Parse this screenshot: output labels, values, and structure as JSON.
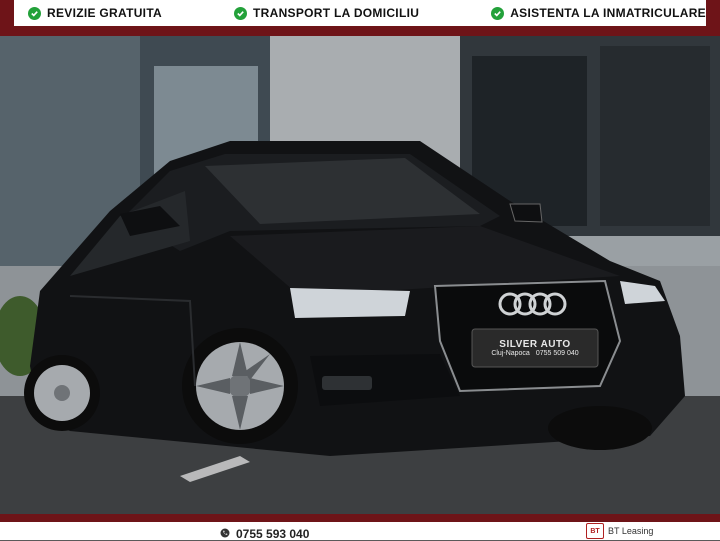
{
  "top_banner": {
    "features": [
      {
        "icon": "check-circle-icon",
        "label": "REVIZIE GRATUITA"
      },
      {
        "icon": "check-circle-icon",
        "label": "TRANSPORT LA DOMICILIU"
      },
      {
        "icon": "check-circle-icon",
        "label": "ASISTENTA LA INMATRICULARE"
      }
    ]
  },
  "photo": {
    "plate": {
      "brand": "SILVER AUTO",
      "city": "Cluj-Napoca",
      "phone": "0755 509 040"
    }
  },
  "bottom_banner": {
    "phone": "0755 593 040",
    "leasing_label": "BT Leasing",
    "leasing_logo_text": "BT"
  },
  "colors": {
    "accent": "#6e1418",
    "check": "#23a13a"
  }
}
